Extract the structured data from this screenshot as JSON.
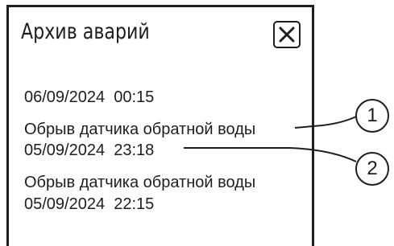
{
  "dialog": {
    "title": "Архив аварий",
    "close_icon": "close-icon"
  },
  "alarms": [
    {
      "timestamp": "06/09/2024  00:15",
      "message": "Обрыв датчика обратной воды"
    },
    {
      "timestamp": "05/09/2024  23:18",
      "message": "Обрыв датчика обратной воды"
    },
    {
      "timestamp": "05/09/2024  22:15"
    }
  ],
  "callouts": [
    {
      "label": "1",
      "target": "alarm message"
    },
    {
      "label": "2",
      "target": "alarm timestamp"
    }
  ]
}
